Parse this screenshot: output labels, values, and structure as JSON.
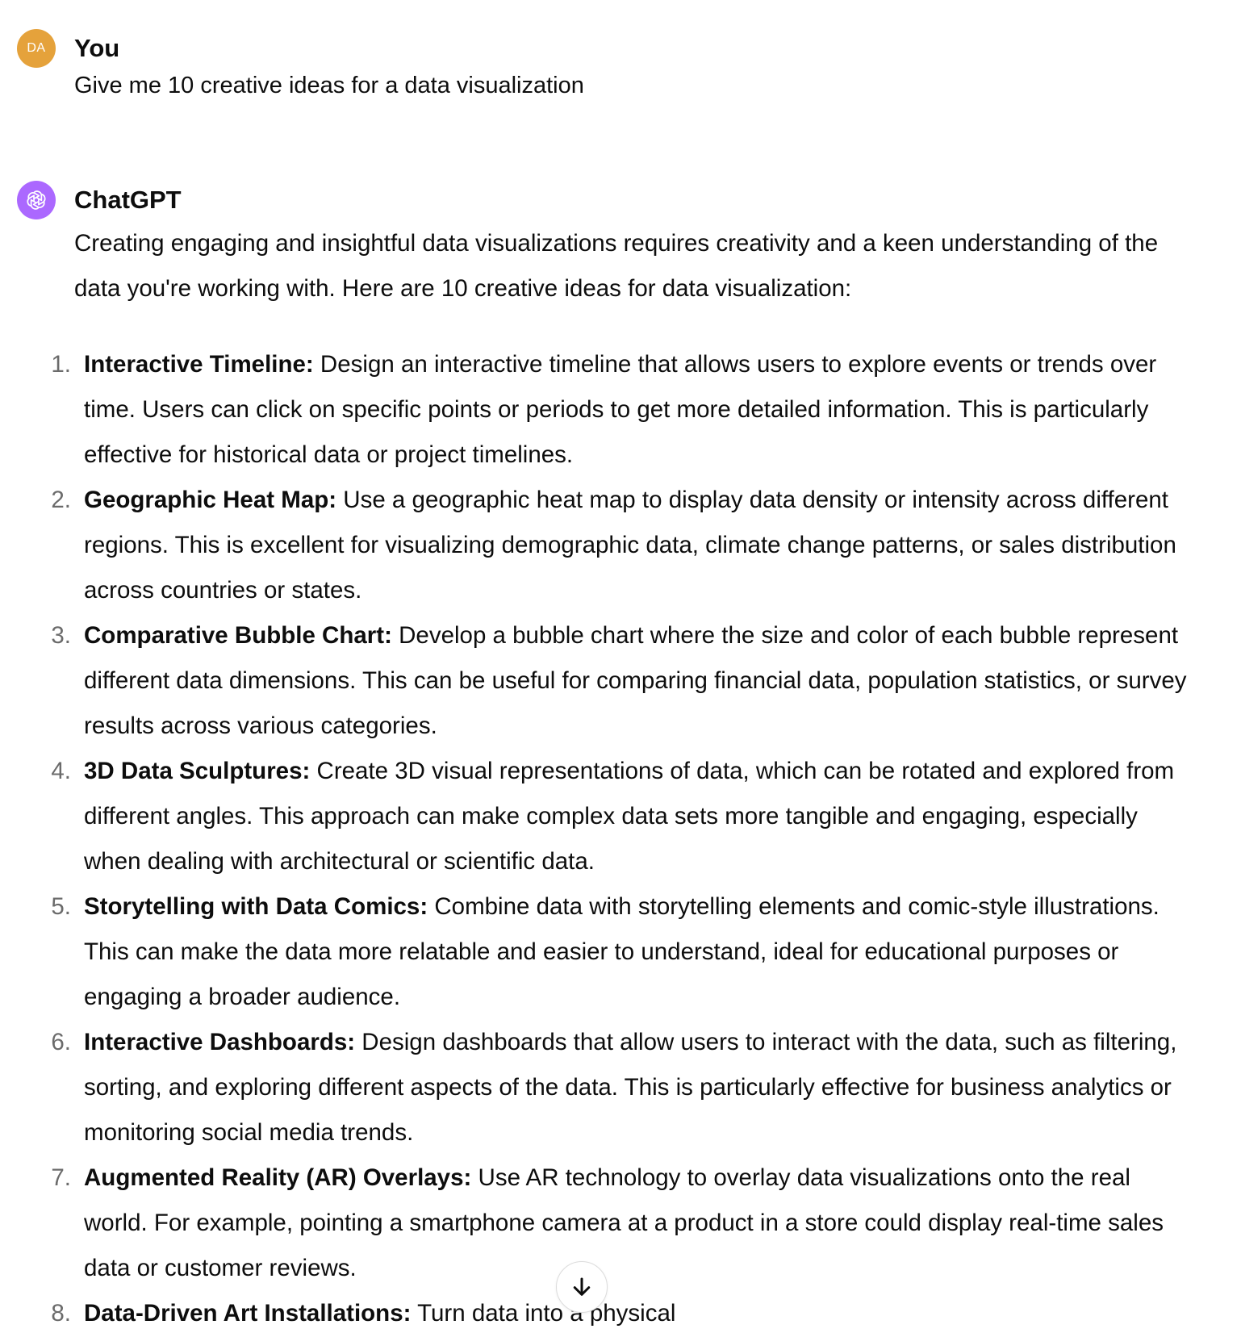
{
  "user_message": {
    "avatar_initials": "DA",
    "avatar_color": "#e5a23b",
    "author": "You",
    "text": "Give me 10 creative ideas for a data visualization"
  },
  "assistant_message": {
    "avatar_icon": "openai-logo-icon",
    "avatar_color": "#ab68ff",
    "author": "ChatGPT",
    "intro": "Creating engaging and insightful data visualizations requires creativity and a keen understanding of the data you're working with. Here are 10 creative ideas for data visualization:",
    "ideas": [
      {
        "num": "1.",
        "title": "Interactive Timeline:",
        "body": " Design an interactive timeline that allows users to explore events or trends over time. Users can click on specific points or periods to get more detailed information. This is particularly effective for historical data or project timelines."
      },
      {
        "num": "2.",
        "title": "Geographic Heat Map:",
        "body": " Use a geographic heat map to display data density or intensity across different regions. This is excellent for visualizing demographic data, climate change patterns, or sales distribution across countries or states."
      },
      {
        "num": "3.",
        "title": "Comparative Bubble Chart:",
        "body": " Develop a bubble chart where the size and color of each bubble represent different data dimensions. This can be useful for comparing financial data, population statistics, or survey results across various categories."
      },
      {
        "num": "4.",
        "title": "3D Data Sculptures:",
        "body": " Create 3D visual representations of data, which can be rotated and explored from different angles. This approach can make complex data sets more tangible and engaging, especially when dealing with architectural or scientific data."
      },
      {
        "num": "5.",
        "title": "Storytelling with Data Comics:",
        "body": " Combine data with storytelling elements and comic-style illustrations. This can make the data more relatable and easier to understand, ideal for educational purposes or engaging a broader audience."
      },
      {
        "num": "6.",
        "title": "Interactive Dashboards:",
        "body": " Design dashboards that allow users to interact with the data, such as filtering, sorting, and exploring different aspects of the data. This is particularly effective for business analytics or monitoring social media trends."
      },
      {
        "num": "7.",
        "title": "Augmented Reality (AR) Overlays:",
        "body": " Use AR technology to overlay data visualizations onto the real world. For example, pointing a smartphone camera at a product in a store could display real-time sales data or customer reviews."
      },
      {
        "num": "8.",
        "title": "Data-Driven Art Installations:",
        "body": " Turn data into a physical"
      }
    ]
  },
  "scroll_button": {
    "icon": "arrow-down-icon"
  }
}
